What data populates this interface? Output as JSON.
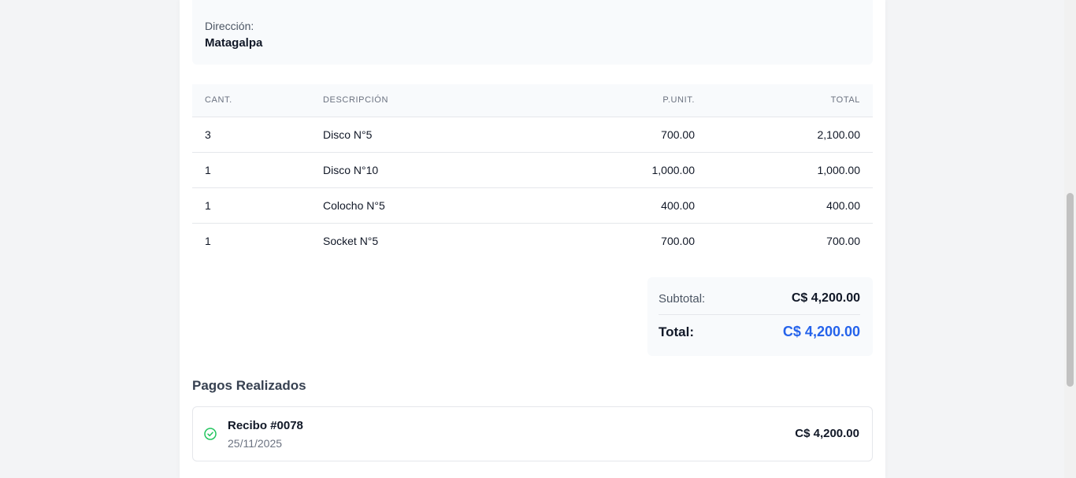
{
  "address": {
    "label": "Dirección:",
    "value": "Matagalpa"
  },
  "items_table": {
    "headers": {
      "qty": "CANT.",
      "desc": "DESCRIPCIÓN",
      "unit": "P.UNIT.",
      "total": "TOTAL"
    },
    "rows": [
      {
        "qty": "3",
        "desc": "Disco N°5",
        "unit": "700.00",
        "total": "2,100.00"
      },
      {
        "qty": "1",
        "desc": "Disco N°10",
        "unit": "1,000.00",
        "total": "1,000.00"
      },
      {
        "qty": "1",
        "desc": "Colocho N°5",
        "unit": "400.00",
        "total": "400.00"
      },
      {
        "qty": "1",
        "desc": "Socket N°5",
        "unit": "700.00",
        "total": "700.00"
      }
    ]
  },
  "totals": {
    "subtotal_label": "Subtotal:",
    "subtotal_value": "C$ 4,200.00",
    "total_label": "Total:",
    "total_value": "C$ 4,200.00",
    "total_color": "#2563eb"
  },
  "payments": {
    "title": "Pagos Realizados",
    "items": [
      {
        "icon": "check-circle-icon",
        "icon_color": "#22c55e",
        "receipt": "Recibo #0078",
        "date": "25/11/2025",
        "amount": "C$ 4,200.00"
      }
    ]
  }
}
